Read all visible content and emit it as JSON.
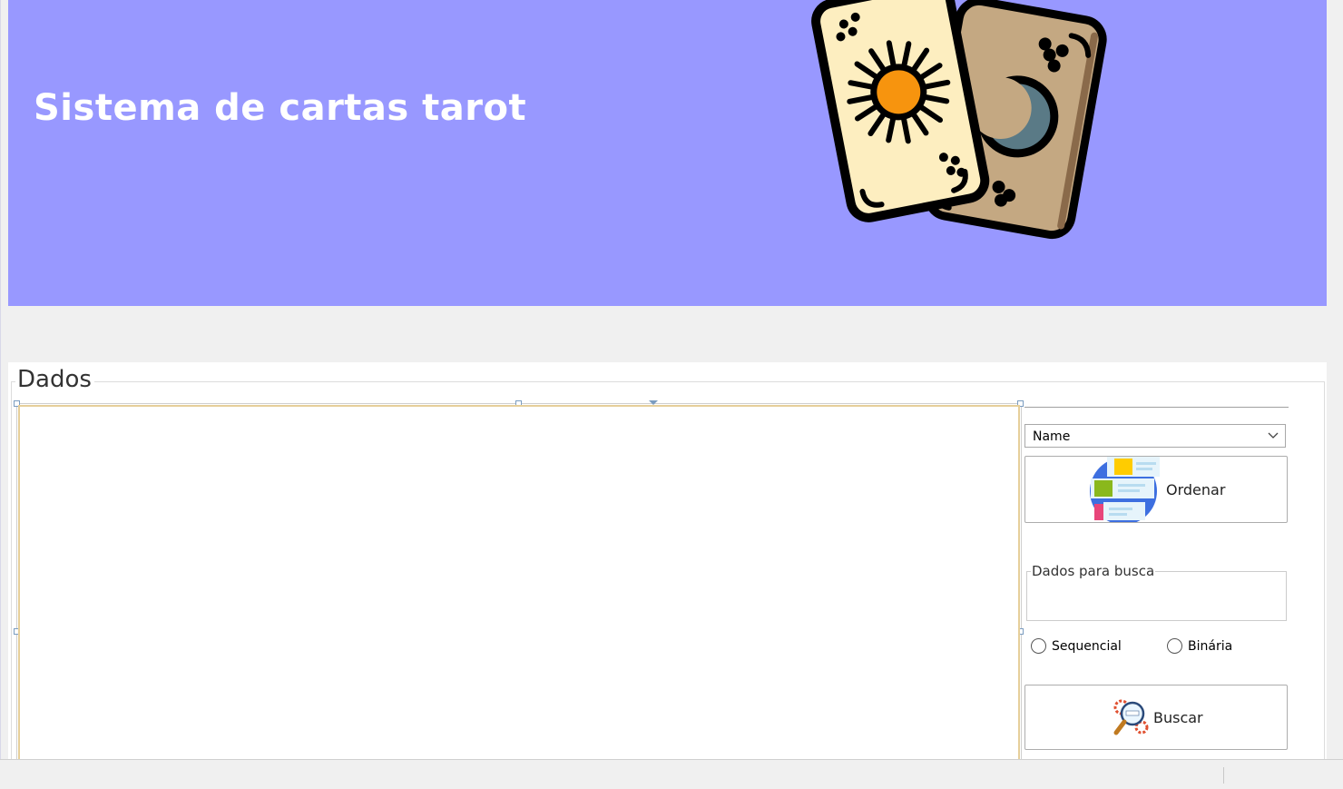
{
  "banner": {
    "title": "Sistema de cartas tarot",
    "background_color": "#9898ff",
    "image_icon": "tarot-cards-icon"
  },
  "dados_group": {
    "title": "Dados"
  },
  "controls": {
    "sort_field_selected": "Name",
    "sort_button_label": "Ordenar",
    "sort_button_icon": "sort-list-icon",
    "search_group_label": "Dados para busca",
    "search_value": "",
    "radio_sequential_label": "Sequencial",
    "radio_binary_label": "Binária",
    "search_button_label": "Buscar",
    "search_button_icon": "search-magnifier-icon"
  }
}
